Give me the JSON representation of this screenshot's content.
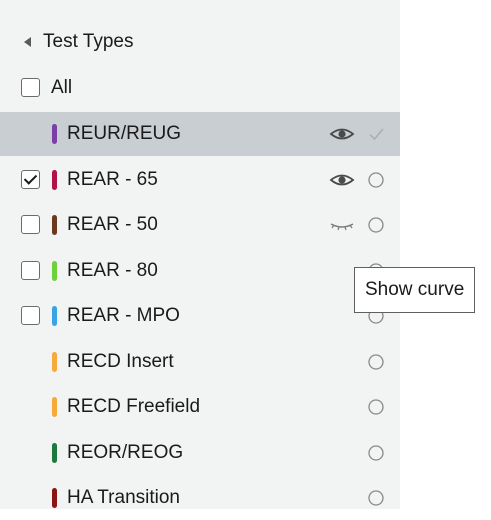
{
  "panel": {
    "title": "Test Types",
    "all_label": "All",
    "all_checked": false
  },
  "items": [
    {
      "label": "REUR/REUG",
      "color": "#7b3fa8",
      "has_checkbox": false,
      "checked": false,
      "visibility": "visible",
      "status": "check",
      "highlighted": true
    },
    {
      "label": "REAR - 65",
      "color": "#b0124a",
      "has_checkbox": true,
      "checked": true,
      "visibility": "visible",
      "status": "circle",
      "highlighted": false
    },
    {
      "label": "REAR - 50",
      "color": "#6b3a1e",
      "has_checkbox": true,
      "checked": false,
      "visibility": "hidden",
      "status": "circle",
      "highlighted": false
    },
    {
      "label": "REAR - 80",
      "color": "#6fd13a",
      "has_checkbox": true,
      "checked": false,
      "visibility": "none",
      "status": "circle",
      "highlighted": false
    },
    {
      "label": "REAR - MPO",
      "color": "#3aa3e6",
      "has_checkbox": true,
      "checked": false,
      "visibility": "none",
      "status": "circle",
      "highlighted": false
    },
    {
      "label": "RECD Insert",
      "color": "#f7a93a",
      "has_checkbox": false,
      "checked": false,
      "visibility": "none",
      "status": "circle",
      "highlighted": false
    },
    {
      "label": "RECD Freefield",
      "color": "#f7a93a",
      "has_checkbox": false,
      "checked": false,
      "visibility": "none",
      "status": "circle",
      "highlighted": false
    },
    {
      "label": "REOR/REOG",
      "color": "#1e7a3c",
      "has_checkbox": false,
      "checked": false,
      "visibility": "none",
      "status": "circle",
      "highlighted": false
    },
    {
      "label": "HA Transition",
      "color": "#8b1515",
      "has_checkbox": false,
      "checked": false,
      "visibility": "none",
      "status": "circle",
      "highlighted": false
    }
  ],
  "icons": {
    "collapse": "caret-left-icon",
    "visible": "eye-icon",
    "hidden": "eye-closed-icon",
    "check": "check-icon",
    "circle": "circle-icon"
  },
  "tooltip": {
    "text": "Show curve"
  }
}
